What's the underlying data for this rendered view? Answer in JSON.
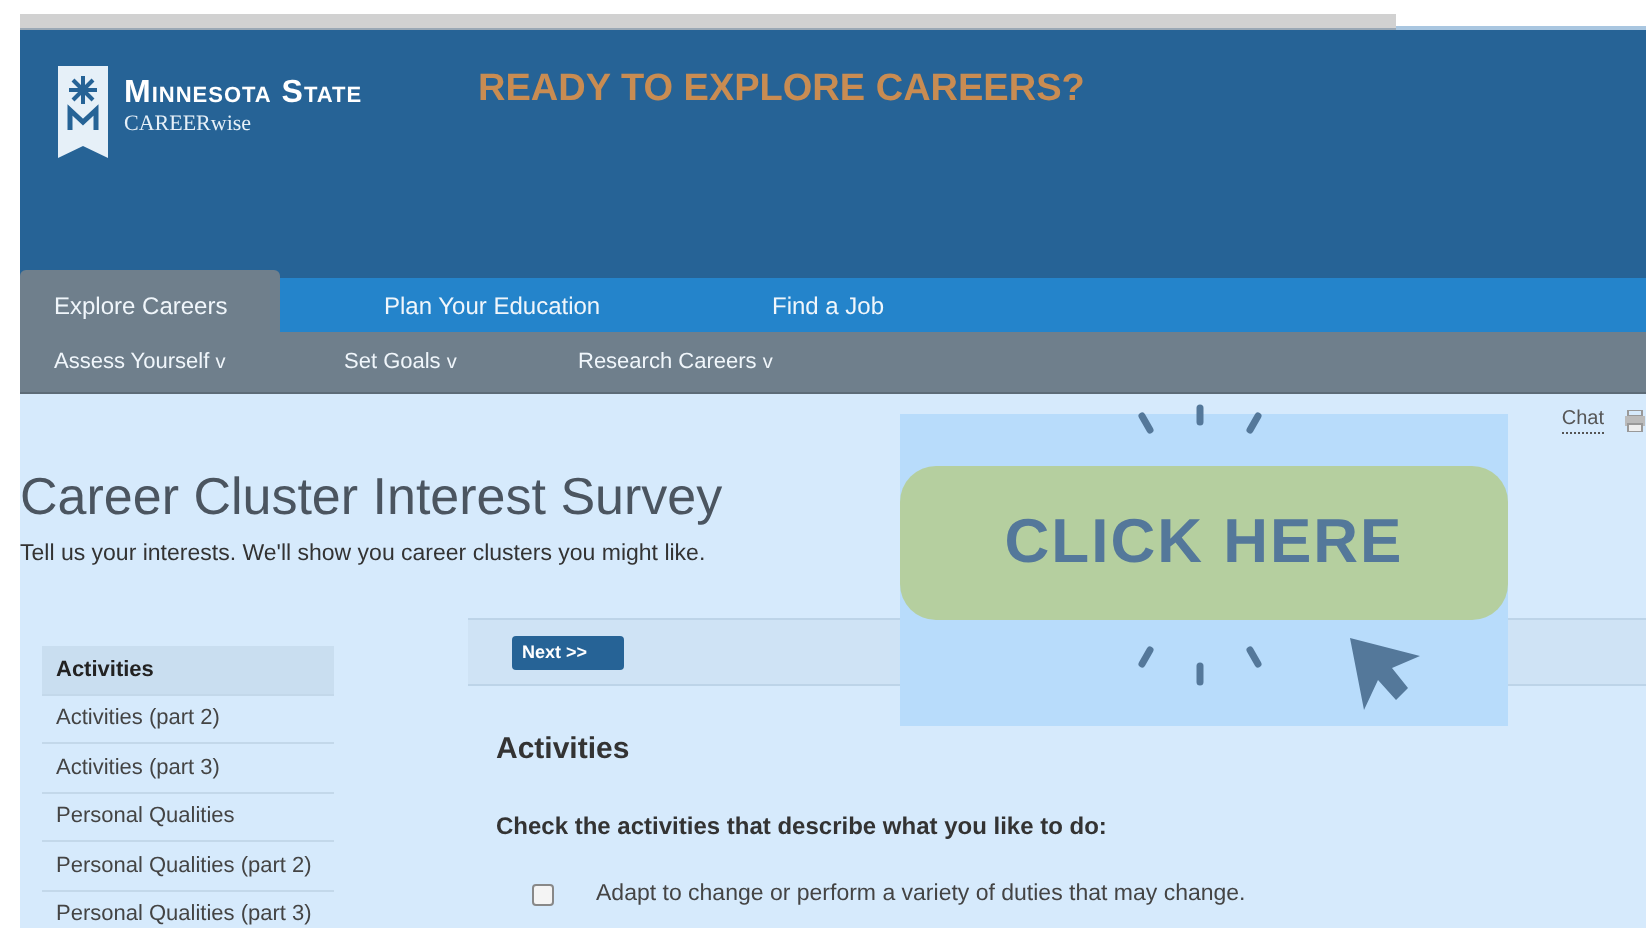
{
  "header": {
    "logo_title": "Minnesota State",
    "logo_subtitle": "CAREERwise",
    "banner": "READY TO EXPLORE CAREERS?"
  },
  "main_nav": [
    {
      "label": "Explore Careers",
      "selected": true
    },
    {
      "label": "Plan Your Education",
      "selected": false
    },
    {
      "label": "Find a Job",
      "selected": false
    }
  ],
  "sub_nav": [
    {
      "label": "Assess Yourself",
      "caret": "v"
    },
    {
      "label": "Set Goals",
      "caret": "v"
    },
    {
      "label": "Research Careers",
      "caret": "v"
    }
  ],
  "tools": {
    "chat": "Chat"
  },
  "page": {
    "title": "Career Cluster Interest Survey",
    "subtitle": "Tell us your interests. We'll show you career clusters you might like."
  },
  "sidebar": {
    "items": [
      {
        "label": "Activities",
        "selected": true
      },
      {
        "label": "Activities (part 2)",
        "selected": false
      },
      {
        "label": "Activities (part 3)",
        "selected": false
      },
      {
        "label": "Personal Qualities",
        "selected": false
      },
      {
        "label": "Personal Qualities (part 2)",
        "selected": false
      },
      {
        "label": "Personal Qualities (part 3)",
        "selected": false
      }
    ]
  },
  "survey": {
    "next_button": "Next >>",
    "section_title": "Activities",
    "instruction": "Check the activities that describe what you like to do:",
    "options": [
      {
        "label": "Adapt to change or perform a variety of duties that may change.",
        "checked": false
      }
    ]
  },
  "overlay": {
    "call_to_action": "CLICK HERE"
  }
}
